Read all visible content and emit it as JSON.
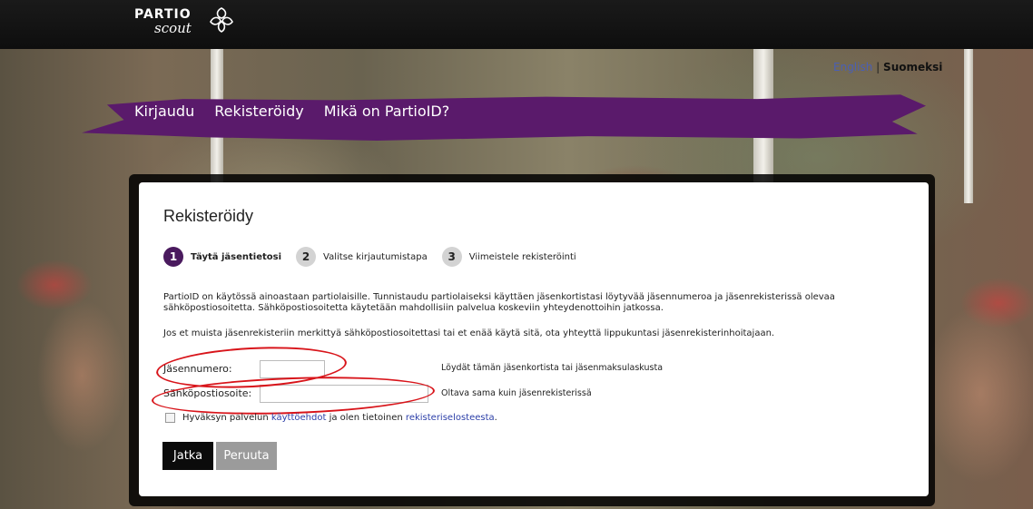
{
  "header": {
    "logo_line1": "PARTIO",
    "logo_line2": "scout"
  },
  "language": {
    "english": "English",
    "separator": "|",
    "finnish": "Suomeksi"
  },
  "nav": {
    "login": "Kirjaudu",
    "register": "Rekisteröidy",
    "what_is": "Mikä on PartioID?"
  },
  "form": {
    "title": "Rekisteröidy",
    "steps": [
      {
        "num": "1",
        "label": "Täytä jäsentietosi"
      },
      {
        "num": "2",
        "label": "Valitse kirjautumistapa"
      },
      {
        "num": "3",
        "label": "Viimeistele rekisteröinti"
      }
    ],
    "intro": "PartioID on käytössä ainoastaan partiolaisille. Tunnistaudu partiolaiseksi käyttäen jäsenkortistasi löytyvää jäsennumeroa ja jäsenrekisterissä olevaa sähköpostiosoitetta. Sähköpostiosoitetta käytetään mahdollisiin palvelua koskeviin yhteydenottoihin jatkossa.",
    "note": "Jos et muista jäsenrekisteriin merkittyä sähköpostiosoitettasi tai et enää käytä sitä, ota yhteyttä lippukuntasi jäsenrekisterinhoitajaan.",
    "member_number_label": "Jäsennumero:",
    "member_number_value": "",
    "member_number_hint": "Löydät tämän jäsenkortista tai jäsenmaksulaskusta",
    "email_label": "Sähköpostiosoite:",
    "email_value": "",
    "email_hint": "Oltava sama kuin jäsenrekisterissä",
    "terms_prefix": "Hyväksyn palvelun",
    "terms_link": "käyttöehdot",
    "terms_middle": "ja olen tietoinen",
    "privacy_link": "rekisteriselosteesta",
    "terms_suffix": ".",
    "continue_button": "Jatka",
    "cancel_button": "Peruuta"
  },
  "colors": {
    "brand_purple": "#5a1a6b",
    "step_active": "#4a1a5e",
    "annotation_red": "#d8141a",
    "link_blue": "#2b3ea8"
  }
}
